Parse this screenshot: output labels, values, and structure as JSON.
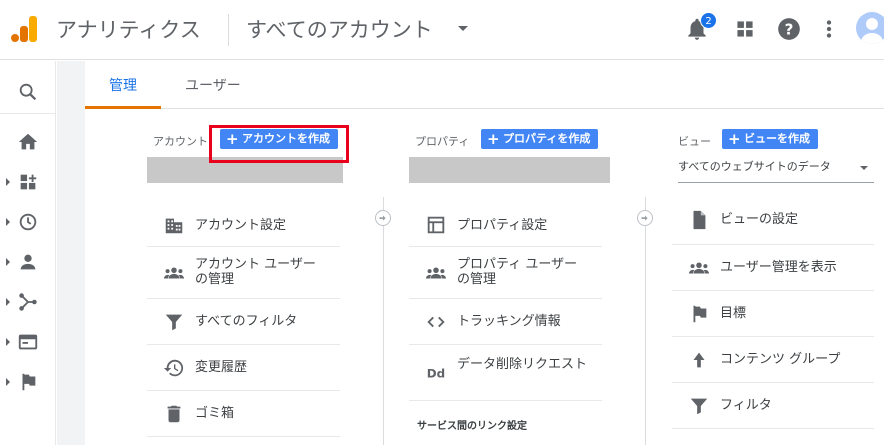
{
  "header": {
    "app_title": "アナリティクス",
    "account_picker": "すべてのアカウント",
    "notification_count": "2"
  },
  "nav": {
    "items": [
      "search-icon",
      "home-icon",
      "dashboard-icon",
      "clock-icon",
      "person-icon",
      "acquisition-icon",
      "behavior-icon",
      "flag-icon"
    ]
  },
  "tabs": {
    "admin": "管理",
    "user": "ユーザー"
  },
  "account_column": {
    "label": "アカウント",
    "create_button": "アカウントを作成",
    "items": [
      {
        "label": "アカウント設定",
        "icon": "building-icon"
      },
      {
        "label": "アカウント ユーザーの管理",
        "icon": "users-icon"
      },
      {
        "label": "すべてのフィルタ",
        "icon": "filter-icon"
      },
      {
        "label": "変更履歴",
        "icon": "history-icon"
      },
      {
        "label": "ゴミ箱",
        "icon": "trash-icon"
      }
    ]
  },
  "property_column": {
    "label": "プロパティ",
    "create_button": "プロパティを作成",
    "items": [
      {
        "label": "プロパティ設定",
        "icon": "window-icon"
      },
      {
        "label": "プロパティ ユーザーの管理",
        "icon": "users-icon"
      },
      {
        "label": "トラッキング情報",
        "icon": "code-icon"
      },
      {
        "label": "データ削除リクエスト",
        "icon": "dd-icon"
      }
    ],
    "section_title": "サービス間のリンク設定"
  },
  "view_column": {
    "label": "ビュー",
    "create_button": "ビューを作成",
    "selector_value": "すべてのウェブサイトのデータ",
    "items": [
      {
        "label": "ビューの設定",
        "icon": "document-icon"
      },
      {
        "label": "ユーザー管理を表示",
        "icon": "users-icon"
      },
      {
        "label": "目標",
        "icon": "flag-icon"
      },
      {
        "label": "コンテンツ グループ",
        "icon": "content-group-icon"
      },
      {
        "label": "フィルタ",
        "icon": "filter-icon"
      }
    ]
  },
  "colors": {
    "accent": "#1a73e8",
    "button": "#4285f4",
    "highlight": "#e8001c",
    "tab_underline": "#e37400"
  }
}
